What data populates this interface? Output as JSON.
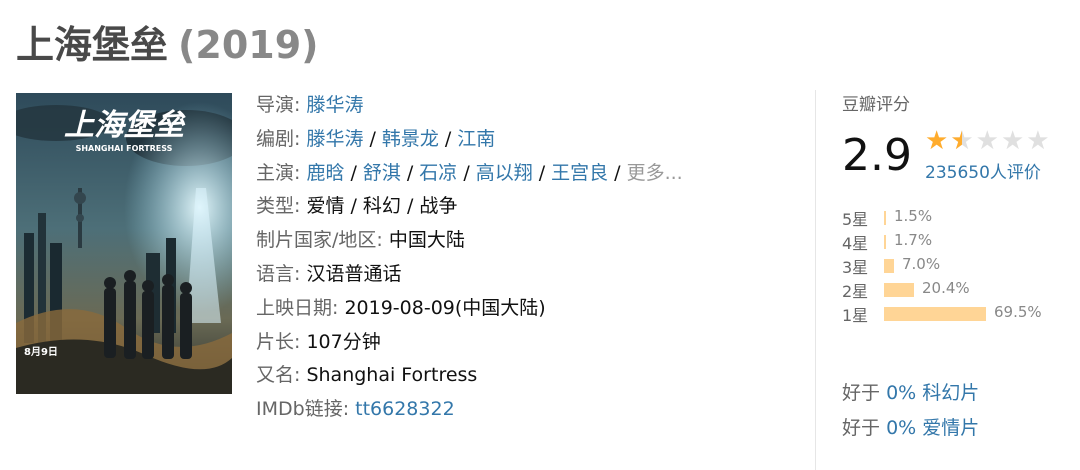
{
  "title": {
    "name": "上海堡垒",
    "year": "(2019)"
  },
  "poster": {
    "title_art": "上海堡垒",
    "subtitle_art": "SHANGHAI FORTRESS",
    "date_art": "8月9日"
  },
  "info": {
    "director": {
      "label": "导演:",
      "names": [
        "滕华涛"
      ]
    },
    "writers": {
      "label": "编剧:",
      "names": [
        "滕华涛",
        "韩景龙",
        "江南"
      ]
    },
    "cast": {
      "label": "主演:",
      "names": [
        "鹿晗",
        "舒淇",
        "石凉",
        "高以翔",
        "王宫良"
      ],
      "more": "更多..."
    },
    "genre": {
      "label": "类型:",
      "value": "爱情 / 科幻 / 战争"
    },
    "country": {
      "label": "制片国家/地区:",
      "value": "中国大陆"
    },
    "language": {
      "label": "语言:",
      "value": "汉语普通话"
    },
    "release": {
      "label": "上映日期:",
      "value": "2019-08-09(中国大陆)"
    },
    "runtime": {
      "label": "片长:",
      "value": "107分钟"
    },
    "aka": {
      "label": "又名:",
      "value": "Shanghai Fortress"
    },
    "imdb": {
      "label": "IMDb链接:",
      "value": "tt6628322"
    }
  },
  "rating": {
    "label": "豆瓣评分",
    "score": "2.9",
    "stars_value": 1.5,
    "votes": "235650人评价",
    "distribution": [
      {
        "label": "5星",
        "percent": 1.5,
        "text": "1.5%"
      },
      {
        "label": "4星",
        "percent": 1.7,
        "text": "1.7%"
      },
      {
        "label": "3星",
        "percent": 7.0,
        "text": "7.0%"
      },
      {
        "label": "2星",
        "percent": 20.4,
        "text": "20.4%"
      },
      {
        "label": "1星",
        "percent": 69.5,
        "text": "69.5%"
      }
    ],
    "better_than": [
      {
        "prefix": "好于",
        "value": "0% 科幻片"
      },
      {
        "prefix": "好于",
        "value": "0% 爱情片"
      }
    ]
  },
  "colors": {
    "link": "#3377aa",
    "star": "#ffac2d",
    "bar": "#ffd596",
    "title": "#494949"
  }
}
